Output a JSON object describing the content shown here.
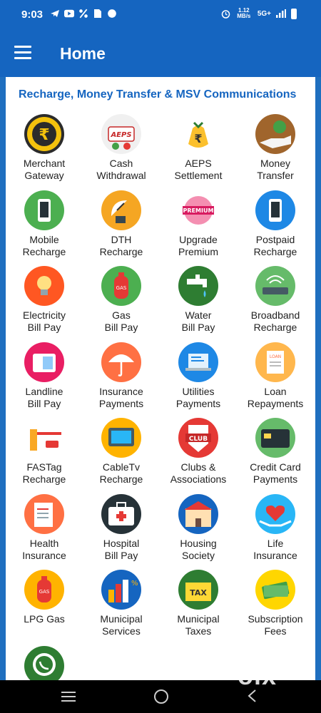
{
  "status": {
    "time": "9:03",
    "network": "1.12 MB/s",
    "signal": "5G+"
  },
  "appbar": {
    "title": "Home"
  },
  "section": {
    "title": "Recharge, Money Transfer & MSV Communications"
  },
  "services": [
    {
      "line1": "Merchant",
      "line2": "Gateway",
      "icon": "rupee-coin-icon",
      "color": "#2b2b2b"
    },
    {
      "line1": "Cash",
      "line2": "Withdrawal",
      "icon": "aeps-fingerprint-icon",
      "color": "#f0f0f0"
    },
    {
      "line1": "AEPS",
      "line2": "Settlement",
      "icon": "money-bag-icon",
      "color": "#ffffff"
    },
    {
      "line1": "Money",
      "line2": "Transfer",
      "icon": "hand-money-icon",
      "color": "#a0652c"
    },
    {
      "line1": "Mobile",
      "line2": "Recharge",
      "icon": "mobile-phone-icon",
      "color": "#4caf50"
    },
    {
      "line1": "DTH",
      "line2": "Recharge",
      "icon": "satellite-dish-icon",
      "color": "#f5a623"
    },
    {
      "line1": "Upgrade",
      "line2": "Premium",
      "icon": "premium-badge-icon",
      "color": "#ffffff"
    },
    {
      "line1": "Postpaid",
      "line2": "Recharge",
      "icon": "mobile-phone-icon",
      "color": "#1e88e5"
    },
    {
      "line1": "Electricity",
      "line2": "Bill Pay",
      "icon": "light-bulb-icon",
      "color": "#ff5722"
    },
    {
      "line1": "Gas",
      "line2": "Bill Pay",
      "icon": "gas-cylinder-icon",
      "color": "#4caf50"
    },
    {
      "line1": "Water",
      "line2": "Bill Pay",
      "icon": "water-tap-icon",
      "color": "#2e7d32"
    },
    {
      "line1": "Broadband",
      "line2": "Recharge",
      "icon": "wifi-router-icon",
      "color": "#66bb6a"
    },
    {
      "line1": "Landline",
      "line2": "Bill Pay",
      "icon": "landline-phone-icon",
      "color": "#e91e63"
    },
    {
      "line1": "Insurance",
      "line2": "Payments",
      "icon": "umbrella-icon",
      "color": "#ff7043"
    },
    {
      "line1": "Utilities",
      "line2": "Payments",
      "icon": "laptop-bill-icon",
      "color": "#1e88e5"
    },
    {
      "line1": "Loan",
      "line2": "Repayments",
      "icon": "loan-document-icon",
      "color": "#ffb74d"
    },
    {
      "line1": "FASTag",
      "line2": "Recharge",
      "icon": "toll-gate-icon",
      "color": "#ffffff"
    },
    {
      "line1": "CableTv",
      "line2": "Recharge",
      "icon": "television-icon",
      "color": "#ffb300"
    },
    {
      "line1": "Clubs &",
      "line2": "Associations",
      "icon": "club-badge-icon",
      "color": "#e53935"
    },
    {
      "line1": "Credit Card",
      "line2": "Payments",
      "icon": "credit-card-icon",
      "color": "#66bb6a"
    },
    {
      "line1": "Health",
      "line2": "Insurance",
      "icon": "health-form-icon",
      "color": "#ff7043"
    },
    {
      "line1": "Hospital",
      "line2": "Bill Pay",
      "icon": "first-aid-kit-icon",
      "color": "#263238"
    },
    {
      "line1": "Housing",
      "line2": "Society",
      "icon": "building-icon",
      "color": "#1565c0"
    },
    {
      "line1": "Life",
      "line2": "Insurance",
      "icon": "heart-hands-icon",
      "color": "#29b6f6"
    },
    {
      "line1": "LPG Gas",
      "line2": "",
      "icon": "lpg-cylinder-icon",
      "color": "#ffb300"
    },
    {
      "line1": "Municipal",
      "line2": "Services",
      "icon": "city-chart-icon",
      "color": "#1565c0"
    },
    {
      "line1": "Municipal",
      "line2": "Taxes",
      "icon": "tax-box-icon",
      "color": "#2e7d32"
    },
    {
      "line1": "Subscription",
      "line2": "Fees",
      "icon": "cash-stack-icon",
      "color": "#ffd600"
    },
    {
      "line1": "",
      "line2": "",
      "icon": "whatsapp-icon",
      "color": "#2e7d32"
    }
  ],
  "watermark": {
    "text": "olx"
  }
}
